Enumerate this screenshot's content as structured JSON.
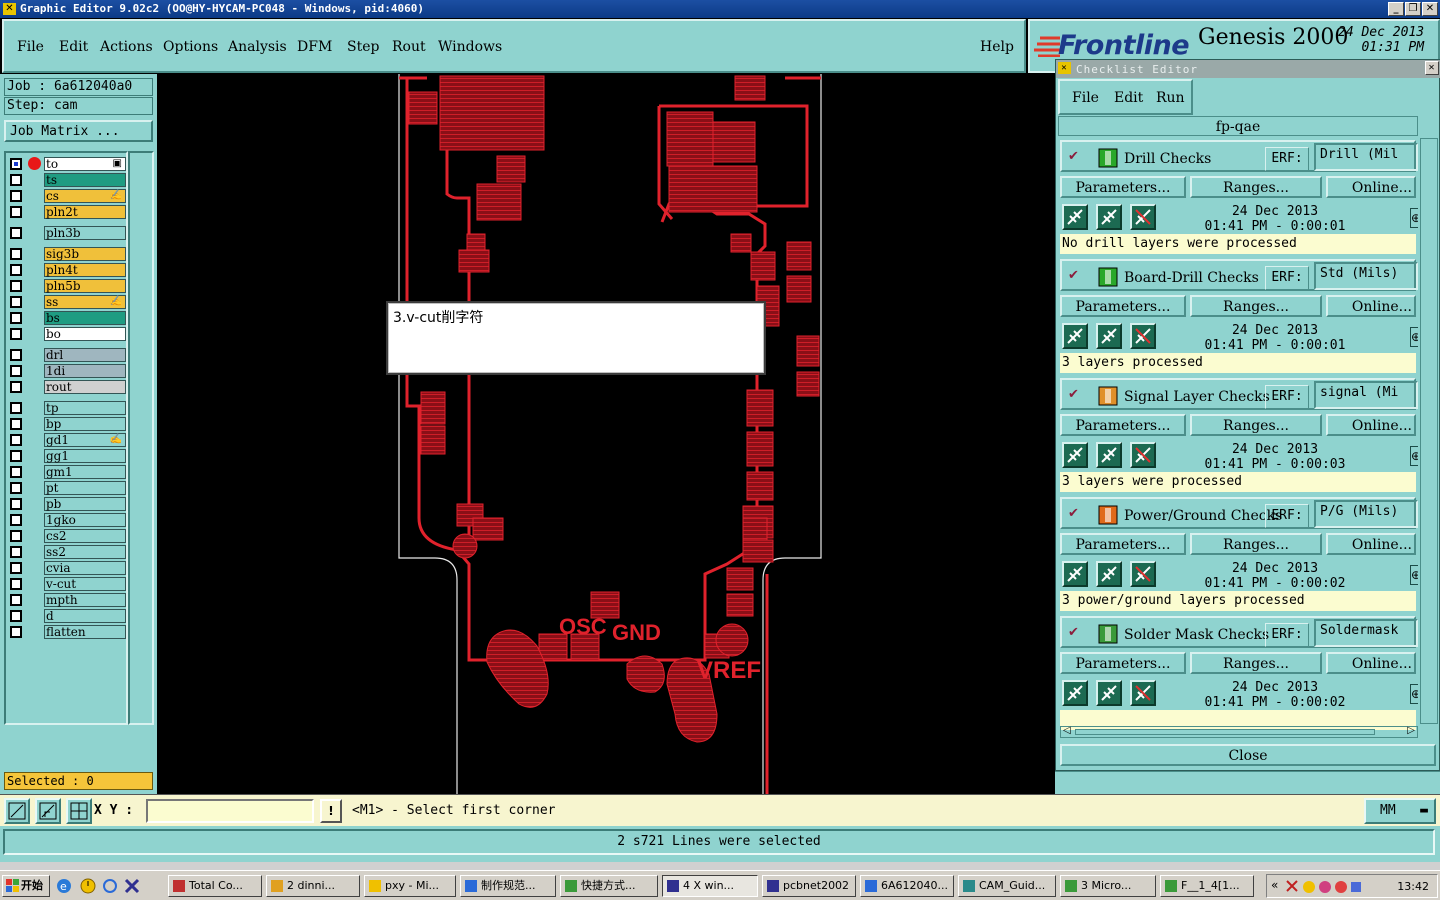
{
  "titlebar": {
    "title": "Graphic Editor 9.02c2  (OO@HY-HYCAM-PC048 - Windows, pid:4060)"
  },
  "menu": [
    "File",
    "Edit",
    "Actions",
    "Options",
    "Analysis",
    "DFM",
    "Step",
    "Rout",
    "Windows"
  ],
  "help": "Help",
  "brand": {
    "name": "Frontline",
    "product": "Genesis 2000",
    "date": "24 Dec 2013",
    "time": "01:31 PM"
  },
  "job": {
    "job_line": "Job : 6a612040a0",
    "step_line": "Step: cam",
    "matrix_button": "Job Matrix ..."
  },
  "layers": [
    {
      "name": "to",
      "color": "#ffffff",
      "flag": "▣"
    },
    {
      "name": "ts",
      "color": "#1f9c82",
      "flag": ""
    },
    {
      "name": "cs",
      "color": "#f0c03a",
      "flag": "✍"
    },
    {
      "name": "pln2t",
      "color": "#f0c03a",
      "flag": ""
    },
    {
      "name": "pln3b",
      "color": "#8fd3cf",
      "flag": ""
    },
    {
      "name": "sig3b",
      "color": "#f0c03a",
      "flag": ""
    },
    {
      "name": "pln4t",
      "color": "#f0c03a",
      "flag": ""
    },
    {
      "name": "pln5b",
      "color": "#f0c03a",
      "flag": ""
    },
    {
      "name": "ss",
      "color": "#f0c03a",
      "flag": "✍"
    },
    {
      "name": "bs",
      "color": "#1f9c82",
      "flag": ""
    },
    {
      "name": "bo",
      "color": "#ffffff",
      "flag": ""
    },
    {
      "name": "drl",
      "color": "#9fb6bf",
      "flag": ""
    },
    {
      "name": "1di",
      "color": "#9fb6bf",
      "flag": ""
    },
    {
      "name": "rout",
      "color": "#d0d0d0",
      "flag": ""
    },
    {
      "name": "tp",
      "color": "#8fd3cf",
      "flag": ""
    },
    {
      "name": "bp",
      "color": "#8fd3cf",
      "flag": ""
    },
    {
      "name": "gd1",
      "color": "#8fd3cf",
      "flag": "✍"
    },
    {
      "name": "gg1",
      "color": "#8fd3cf",
      "flag": ""
    },
    {
      "name": "gm1",
      "color": "#8fd3cf",
      "flag": ""
    },
    {
      "name": "pt",
      "color": "#8fd3cf",
      "flag": ""
    },
    {
      "name": "pb",
      "color": "#8fd3cf",
      "flag": ""
    },
    {
      "name": "1gko",
      "color": "#8fd3cf",
      "flag": ""
    },
    {
      "name": "cs2",
      "color": "#8fd3cf",
      "flag": ""
    },
    {
      "name": "ss2",
      "color": "#8fd3cf",
      "flag": ""
    },
    {
      "name": "cvia",
      "color": "#8fd3cf",
      "flag": ""
    },
    {
      "name": "v-cut",
      "color": "#8fd3cf",
      "flag": ""
    },
    {
      "name": "mpth",
      "color": "#8fd3cf",
      "flag": ""
    },
    {
      "name": "d",
      "color": "#8fd3cf",
      "flag": ""
    },
    {
      "name": "flatten",
      "color": "#8fd3cf",
      "flag": ""
    }
  ],
  "selected": "Selected : 0",
  "canvas": {
    "labels": [
      "OSC",
      "GND",
      "VREF"
    ],
    "note": "3.v-cut削字符"
  },
  "checklist": {
    "title": "Checklist Editor",
    "menu": [
      "File",
      "Edit",
      "Run"
    ],
    "name": "fp-qae",
    "erf_label": "ERF:",
    "buttons": [
      "Parameters...",
      "Ranges...",
      "Online..."
    ],
    "checks": [
      {
        "title": "Drill Checks",
        "erf": "Drill (Mil",
        "date": "24 Dec 2013",
        "time": "01:41  PM - 0:00:01",
        "result": "No drill layers were processed",
        "icon": "drill-icon"
      },
      {
        "title": "Board-Drill Checks",
        "erf": "Std (Mils)",
        "date": "24 Dec 2013",
        "time": "01:41  PM - 0:00:01",
        "result": "3 layers processed",
        "icon": "board-drill-icon"
      },
      {
        "title": "Signal Layer Checks",
        "erf": "signal (Mi",
        "date": "24 Dec 2013",
        "time": "01:41  PM - 0:00:03",
        "result": "3 layers were processed",
        "icon": "signal-layer-icon"
      },
      {
        "title": "Power/Ground Checks",
        "erf": "P/G (Mils)",
        "date": "24 Dec 2013",
        "time": "01:41  PM - 0:00:02",
        "result": "3 power/ground layers processed",
        "icon": "power-ground-icon"
      },
      {
        "title": "Solder Mask Checks",
        "erf": "Soldermask",
        "date": "24 Dec 2013",
        "time": "01:41  PM - 0:00:02",
        "result": "",
        "icon": "solder-mask-icon"
      }
    ],
    "close": "Close"
  },
  "command": {
    "xy_label": "X Y :",
    "xy_value": "",
    "bang": "!",
    "prompt": "<M1> - Select first corner",
    "units": "MM"
  },
  "status": "2 s721 Lines were selected",
  "taskbar": {
    "start": "开始",
    "tasks": [
      "Total Co...",
      "2 dinni...",
      "pxy - Mi...",
      "制作规范...",
      "快捷方式...",
      "4 X win...",
      "pcbnet2002",
      "6A612040...",
      "CAM_Guid...",
      "3 Micro...",
      "F__1_4[1..."
    ],
    "clock": "13:42"
  }
}
